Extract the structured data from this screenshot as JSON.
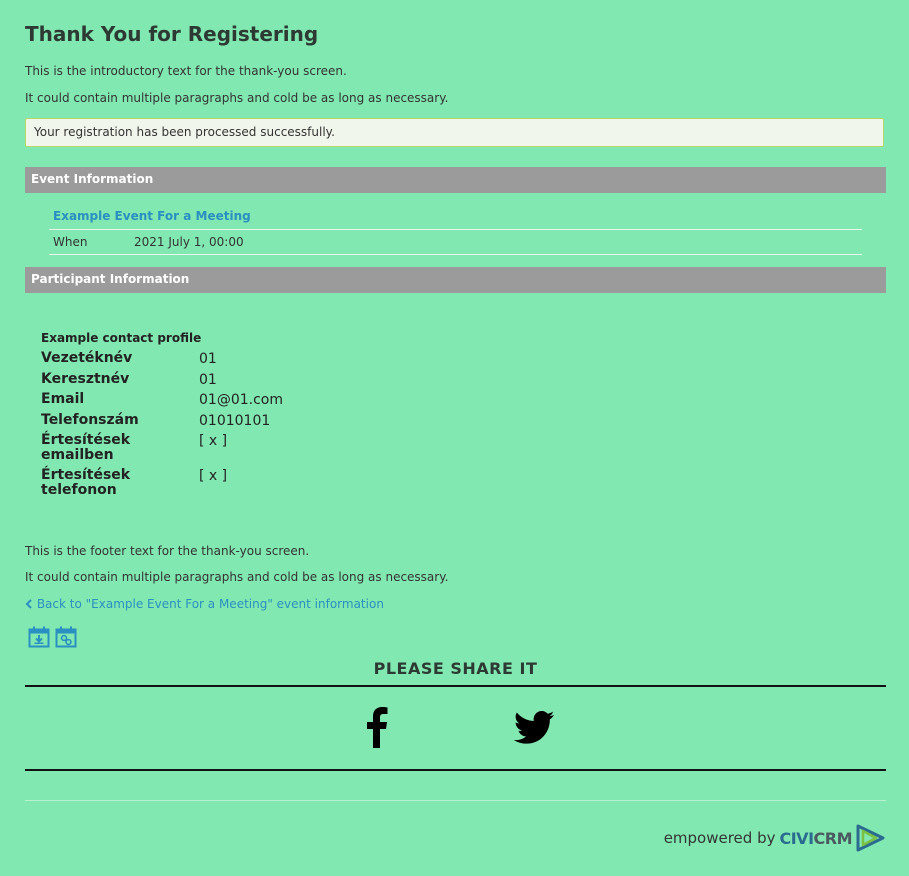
{
  "page": {
    "title": "Thank You for Registering",
    "intro": [
      "This is the introductory text for the thank-you screen.",
      "It could contain multiple paragraphs and cold be as long as necessary."
    ],
    "status_message": "Your registration has been processed successfully."
  },
  "event_info": {
    "header": "Event Information",
    "event_title": "Example Event For a Meeting",
    "when_label": "When",
    "when_value": "2021 July 1, 00:00"
  },
  "participant_info": {
    "header": "Participant Information",
    "profile_title": "Example contact profile",
    "fields": [
      {
        "label": "Vezetéknév",
        "value": "01"
      },
      {
        "label": "Keresztnév",
        "value": "01"
      },
      {
        "label": "Email",
        "value": "01@01.com"
      },
      {
        "label": "Telefonszám",
        "value": "01010101"
      },
      {
        "label": "Értesítések emailben",
        "value": "[ x ]"
      },
      {
        "label": "Értesítések telefonon",
        "value": "[ x ]"
      }
    ]
  },
  "footer": {
    "text": [
      "This is the footer text for the thank-you screen.",
      "It could contain multiple paragraphs and cold be as long as necessary."
    ],
    "back_link": "Back to \"Example Event For a Meeting\" event information",
    "share_title": "PLEASE SHARE IT",
    "powered_prefix": "empowered by",
    "brand_part1": "CIVI",
    "brand_part2": "CRM"
  },
  "icons": {
    "calendar_download": "calendar-download-icon",
    "calendar_link": "calendar-link-icon",
    "facebook": "facebook-icon",
    "twitter": "twitter-icon",
    "chevron": "chevron-left-icon",
    "civicrm_logo": "civicrm-logo-icon"
  },
  "colors": {
    "background": "#82e8b1",
    "link": "#2a8fc1",
    "section_header": "#9b9b9b",
    "success_bg": "#f1f6ec",
    "success_border": "#b7d76a"
  }
}
